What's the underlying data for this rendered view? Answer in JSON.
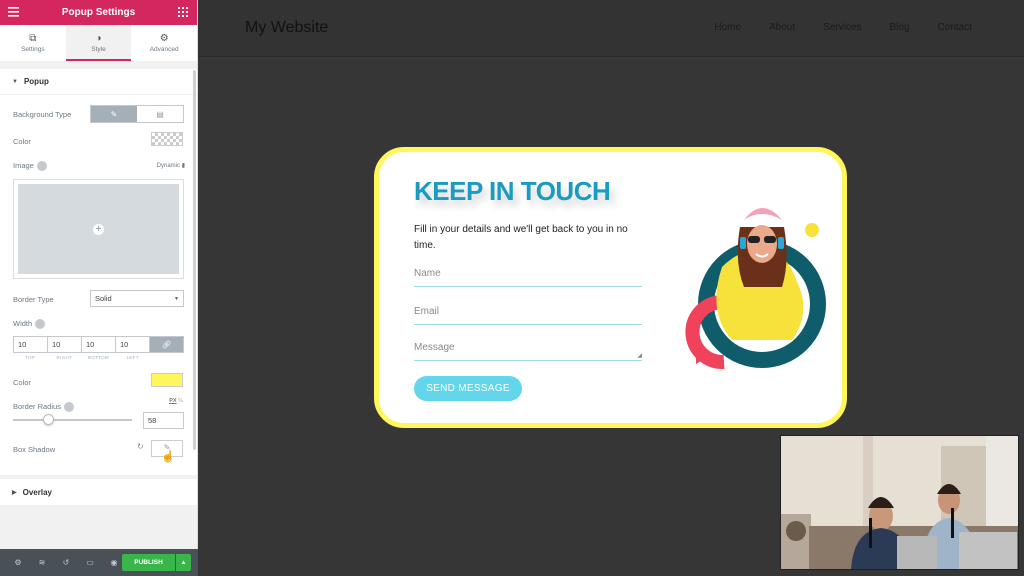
{
  "sidebar": {
    "title": "Popup Settings",
    "tabs": [
      {
        "label": "Settings",
        "icon": "settings-icon"
      },
      {
        "label": "Style",
        "icon": "contrast-icon"
      },
      {
        "label": "Advanced",
        "icon": "gear-icon"
      }
    ],
    "section_title": "Popup",
    "background_type_label": "Background Type",
    "color_label": "Color",
    "image_label": "Image",
    "dynamic_label": "Dynamic",
    "border_type_label": "Border Type",
    "border_type_value": "Solid",
    "width_label": "Width",
    "widths": {
      "top": "10",
      "right": "10",
      "bottom": "10",
      "left": "10"
    },
    "width_sublabels": [
      "TOP",
      "RIGHT",
      "BOTTOM",
      "LEFT"
    ],
    "border_color_label": "Color",
    "border_color": "#fef65b",
    "border_radius_label": "Border Radius",
    "unit_px": "PX",
    "unit_pct": "%",
    "border_radius_value": "58",
    "border_radius_fraction": 0.25,
    "box_shadow_label": "Box Shadow",
    "overlay_title": "Overlay",
    "publish_label": "PUBLISH",
    "accent": "#d5275f"
  },
  "site": {
    "title": "My Website",
    "nav": [
      "Home",
      "About",
      "Services",
      "Blog",
      "Contact"
    ]
  },
  "popup": {
    "title": "KEEP IN TOUCH",
    "description": "Fill in your details and we'll get back to you in no time.",
    "name_placeholder": "Name",
    "email_placeholder": "Email",
    "message_placeholder": "Message",
    "button_label": "SEND MESSAGE",
    "title_color": "#1b9bc0",
    "button_color": "#63d6ec"
  }
}
